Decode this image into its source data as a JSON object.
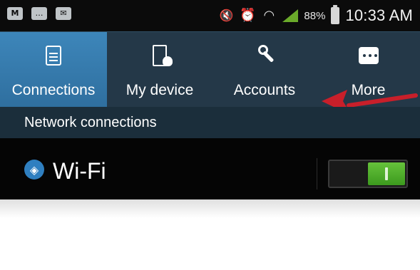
{
  "status_bar": {
    "left_icons": [
      "gmail-icon",
      "messenger-icon",
      "email-icon"
    ],
    "right_icons": [
      "mute-icon",
      "alarm-icon",
      "wifi-icon",
      "signal-icon",
      "battery-icon"
    ],
    "battery_percent": "88%",
    "time": "10:33 AM"
  },
  "tabs": [
    {
      "label": "Connections",
      "icon": "connections-icon",
      "active": true
    },
    {
      "label": "My device",
      "icon": "device-icon",
      "active": false
    },
    {
      "label": "Accounts",
      "icon": "key-icon",
      "active": false
    },
    {
      "label": "More",
      "icon": "more-icon",
      "active": false
    }
  ],
  "section": {
    "title": "Network connections"
  },
  "settings": [
    {
      "label": "Wi-Fi",
      "icon": "wifi-icon",
      "toggle": "on"
    }
  ],
  "annotation": {
    "type": "red-arrow",
    "points_to": "Accounts",
    "color": "#c81f2a"
  },
  "colors": {
    "tab_bar_bg": "#243848",
    "active_tab_bg": "#3d86ba",
    "section_bg": "#1b2e3b",
    "row_bg": "#050505",
    "toggle_on": "#4caf2a"
  }
}
